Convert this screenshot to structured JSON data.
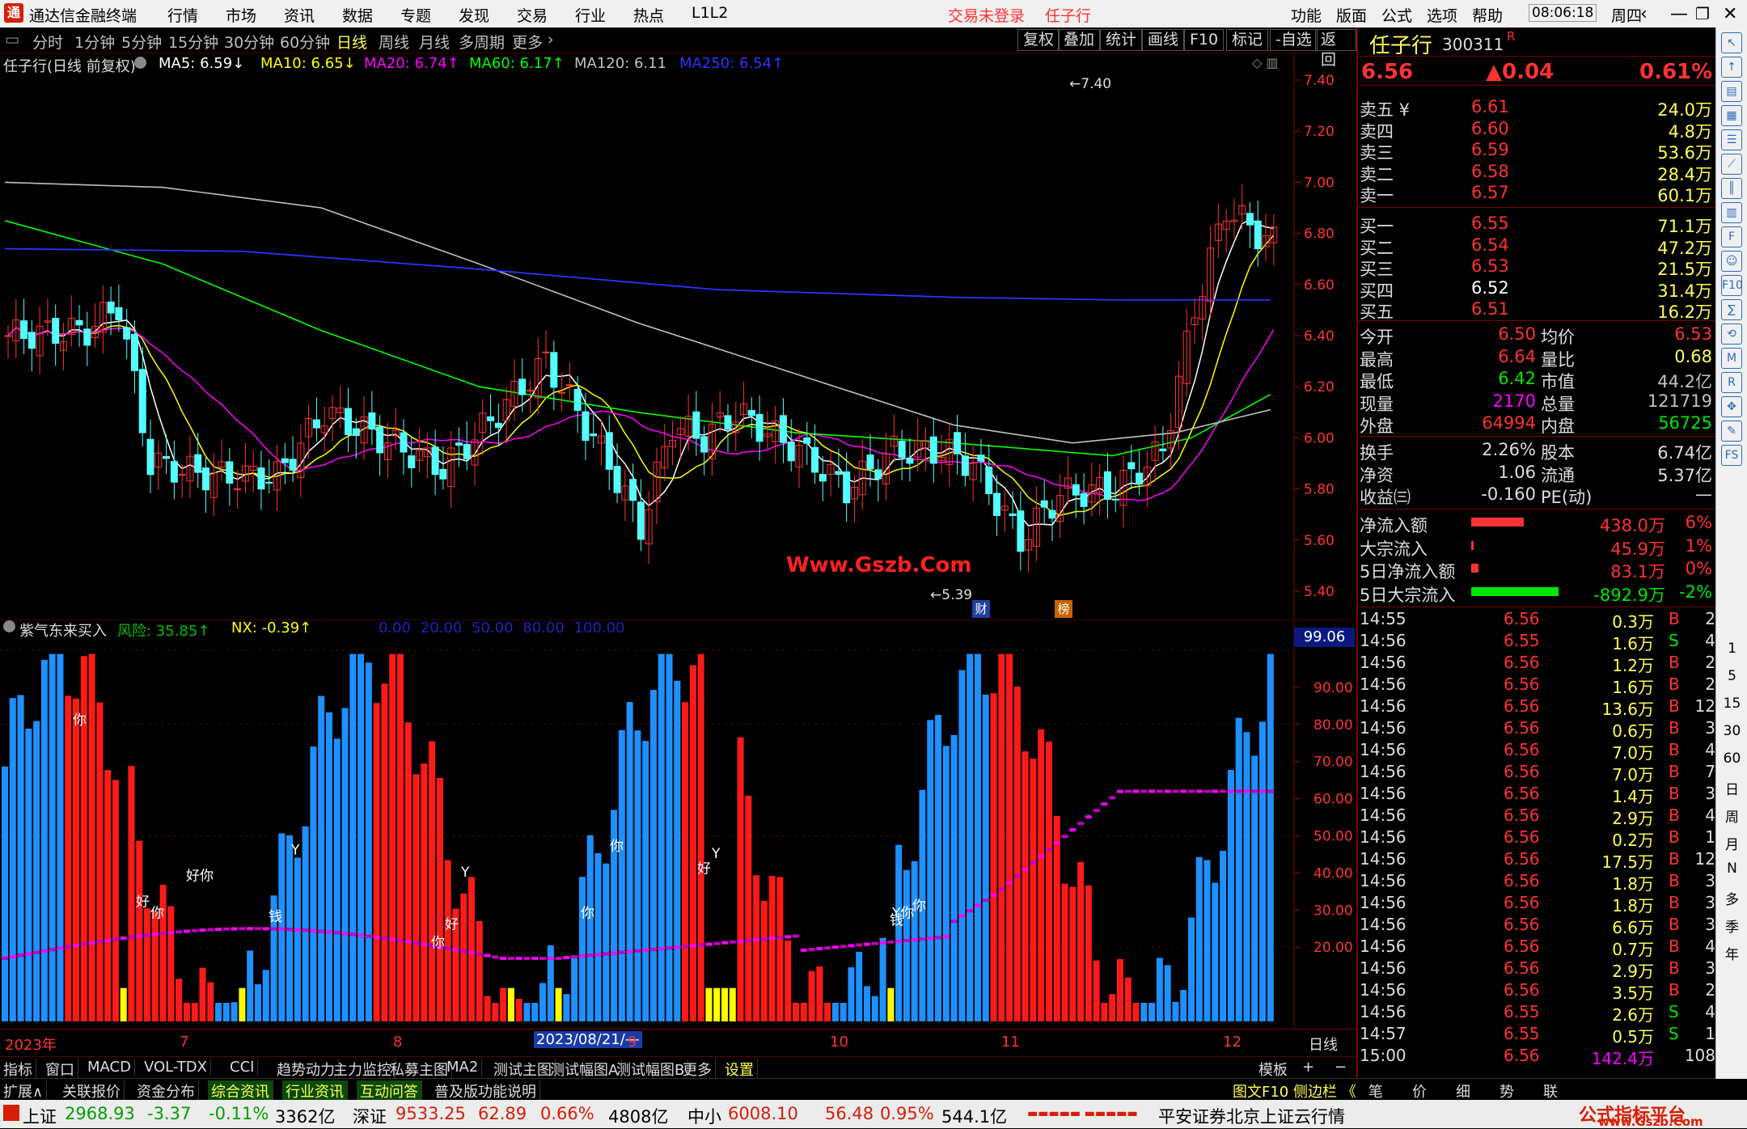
{
  "app": {
    "title": "通达信金融终端",
    "menus": [
      "行情",
      "市场",
      "资讯",
      "数据",
      "专题",
      "发现",
      "交易",
      "行业",
      "热点",
      "L1L2"
    ],
    "login_status": "交易未登录",
    "stock_short": "任子行",
    "right_menus": [
      "功能",
      "版面",
      "公式",
      "选项",
      "帮助"
    ],
    "time": "08:06:18",
    "weekday": "周四"
  },
  "periods": [
    "分时",
    "1分钟",
    "5分钟",
    "15分钟",
    "30分钟",
    "60分钟",
    "日线",
    "周线",
    "月线",
    "多周期",
    "更多"
  ],
  "active_period": "日线",
  "toolbar_buttons": [
    "复权",
    "叠加",
    "统计",
    "画线",
    "F10",
    "标记",
    "-自选",
    "返回"
  ],
  "main": {
    "title": "任子行(日线 前复权)",
    "ma": [
      {
        "label": "MA5: 6.59↓",
        "color": "#ffffff"
      },
      {
        "label": "MA10: 6.65↓",
        "color": "#ffff00"
      },
      {
        "label": "MA20: 6.74↑",
        "color": "#ff00ff"
      },
      {
        "label": "MA60: 6.17↑",
        "color": "#00ff00"
      },
      {
        "label": "MA120: 6.11",
        "color": "#c0c0c0"
      },
      {
        "label": "MA250: 6.54↑",
        "color": "#3030ff"
      }
    ],
    "y_ticks": [
      "7.40",
      "7.20",
      "7.00",
      "6.80",
      "6.60",
      "6.40",
      "6.20",
      "6.00",
      "5.80",
      "5.60",
      "5.40"
    ],
    "high_label": "7.40",
    "low_label": "5.39",
    "watermark": "Www.Gszb.Com",
    "badge1": "财",
    "badge2": "榜"
  },
  "sub": {
    "title": "紫气东来买入",
    "risk": "风险: 35.85↑",
    "nx": "NX: -0.39↑",
    "levels": "0.00 20.00 50.00 80.00 100.00",
    "current_value": "99.06",
    "y_ticks": [
      "90.00",
      "80.00",
      "70.00",
      "60.00",
      "50.00",
      "40.00",
      "30.00",
      "20.00"
    ],
    "markers": [
      "你",
      "好",
      "你",
      "好你",
      "钱",
      "Y",
      "你",
      "你",
      "好",
      "Y",
      "你",
      "好",
      "钱",
      "Y",
      "Y你",
      "你"
    ]
  },
  "x_axis": {
    "labels": [
      "2023年",
      "7",
      "8",
      "9",
      "10",
      "11",
      "12"
    ],
    "cursor_date": "2023/08/21/—",
    "right": "日线"
  },
  "quote": {
    "name": "任子行",
    "code": "300311",
    "flag": "R",
    "price": "6.56",
    "change": "▲0.04",
    "pct": "0.61%",
    "asks": [
      {
        "label": "卖五 ¥",
        "price": "6.61",
        "vol": "24.0万"
      },
      {
        "label": "卖四",
        "price": "6.60",
        "vol": "4.8万"
      },
      {
        "label": "卖三",
        "price": "6.59",
        "vol": "53.6万"
      },
      {
        "label": "卖二",
        "price": "6.58",
        "vol": "28.4万"
      },
      {
        "label": "卖一",
        "price": "6.57",
        "vol": "60.1万"
      }
    ],
    "bids": [
      {
        "label": "买一",
        "price": "6.55",
        "vol": "71.1万"
      },
      {
        "label": "买二",
        "price": "6.54",
        "vol": "47.2万"
      },
      {
        "label": "买三",
        "price": "6.53",
        "vol": "21.5万"
      },
      {
        "label": "买四",
        "price": "6.52",
        "vol": "31.4万"
      },
      {
        "label": "买五",
        "price": "6.51",
        "vol": "16.2万"
      }
    ],
    "stats": [
      {
        "l1": "今开",
        "v1": "6.50",
        "c1": "#ff3232",
        "l2": "均价",
        "v2": "6.53",
        "c2": "#ff3232"
      },
      {
        "l1": "最高",
        "v1": "6.64",
        "c1": "#ff3232",
        "l2": "量比",
        "v2": "0.68",
        "c2": "#ffff54"
      },
      {
        "l1": "最低",
        "v1": "6.42",
        "c1": "#00e600",
        "l2": "市值",
        "v2": "44.2亿",
        "c2": "#c0c0c0"
      },
      {
        "l1": "现量",
        "v1": "2170",
        "c1": "#ff00ff",
        "l2": "总量",
        "v2": "121719",
        "c2": "#c0c0c0"
      },
      {
        "l1": "外盘",
        "v1": "64994",
        "c1": "#ff3232",
        "l2": "内盘",
        "v2": "56725",
        "c2": "#00e600"
      }
    ],
    "stats2": [
      {
        "l1": "换手",
        "v1": "2.26%",
        "l2": "股本",
        "v2": "6.74亿"
      },
      {
        "l1": "净资",
        "v1": "1.06",
        "l2": "流通",
        "v2": "5.37亿"
      },
      {
        "l1": "收益㈢",
        "v1": "-0.160",
        "l2": "PE(动)",
        "v2": "—"
      }
    ],
    "flows": [
      {
        "label": "净流入额",
        "value": "438.0万",
        "pct": "6%",
        "bar": 0.6,
        "color": "#ff3232"
      },
      {
        "label": "大宗流入",
        "value": "45.9万",
        "pct": "1%",
        "bar": 0.03,
        "color": "#ff3232"
      },
      {
        "label": "5日净流入额",
        "value": "83.1万",
        "pct": "0%",
        "bar": 0.08,
        "color": "#ff3232"
      },
      {
        "label": "5日大宗流入",
        "value": "-892.9万",
        "pct": "-2%",
        "bar": 1.0,
        "color": "#00e600"
      }
    ],
    "ticks": [
      [
        "14:55",
        "6.56",
        "0.3万",
        "B",
        "2"
      ],
      [
        "14:56",
        "6.55",
        "1.6万",
        "S",
        "4"
      ],
      [
        "14:56",
        "6.56",
        "1.2万",
        "B",
        "2"
      ],
      [
        "14:56",
        "6.56",
        "1.6万",
        "B",
        "2"
      ],
      [
        "14:56",
        "6.56",
        "13.6万",
        "B",
        "12"
      ],
      [
        "14:56",
        "6.56",
        "0.6万",
        "B",
        "3"
      ],
      [
        "14:56",
        "6.56",
        "7.0万",
        "B",
        "4"
      ],
      [
        "14:56",
        "6.56",
        "7.0万",
        "B",
        "7"
      ],
      [
        "14:56",
        "6.56",
        "1.4万",
        "B",
        "3"
      ],
      [
        "14:56",
        "6.56",
        "2.9万",
        "B",
        "4"
      ],
      [
        "14:56",
        "6.56",
        "0.2万",
        "B",
        "1"
      ],
      [
        "14:56",
        "6.56",
        "17.5万",
        "B",
        "12"
      ],
      [
        "14:56",
        "6.56",
        "1.8万",
        "B",
        "3"
      ],
      [
        "14:56",
        "6.56",
        "1.8万",
        "B",
        "3"
      ],
      [
        "14:56",
        "6.56",
        "6.6万",
        "B",
        "3"
      ],
      [
        "14:56",
        "6.56",
        "0.7万",
        "B",
        "4"
      ],
      [
        "14:56",
        "6.56",
        "2.9万",
        "B",
        "3"
      ],
      [
        "14:56",
        "6.56",
        "3.5万",
        "B",
        "2"
      ],
      [
        "14:56",
        "6.55",
        "2.6万",
        "S",
        "4"
      ],
      [
        "14:57",
        "6.55",
        "0.5万",
        "S",
        "1"
      ],
      [
        "15:00",
        "6.56",
        "142.4万",
        "",
        "108"
      ]
    ],
    "bottom_tabs": [
      "笔",
      "价",
      "细",
      "势",
      "联"
    ]
  },
  "bottom_tabs1": [
    "指标",
    "窗口",
    "MACD",
    "VOL-TDX",
    "CCI",
    "趋势动力",
    "主力监控",
    "私募主图",
    "MA2",
    "测试主图",
    "测试幅图A",
    "测试幅图B",
    "更多",
    "设置"
  ],
  "bottom_right1": [
    "模板",
    "+",
    "−"
  ],
  "bottom_tabs2": [
    "扩展∧",
    "关联报价",
    "资金分布",
    "综合资讯",
    "行业资讯",
    "互动问答",
    "普及版功能说明"
  ],
  "bottom_right2": "图文F10 侧边栏 《",
  "status": {
    "sh_label": "上证",
    "sh": "2968.93",
    "sh_chg": "-3.37",
    "sh_pct": "-0.11%",
    "sh_amt": "3362亿",
    "sz_label": "深证",
    "sz": "9533.25",
    "sz_chg": "62.89",
    "sz_pct": "0.66%",
    "sz_amt": "4808亿",
    "zx_label": "中小",
    "zx": "6008.10",
    "zx_chg": "56.48",
    "zx_pct": "0.95%",
    "zx_amt": "544.1亿",
    "broker": "平安证券北京上证云行情",
    "site": "公式指标平台",
    "site_url": "www.Gszb.Com"
  },
  "rightbar": {
    "labels": [
      "1",
      "5",
      "15",
      "30",
      "60",
      "日",
      "周",
      "月",
      "N",
      "多",
      "季",
      "年"
    ]
  }
}
